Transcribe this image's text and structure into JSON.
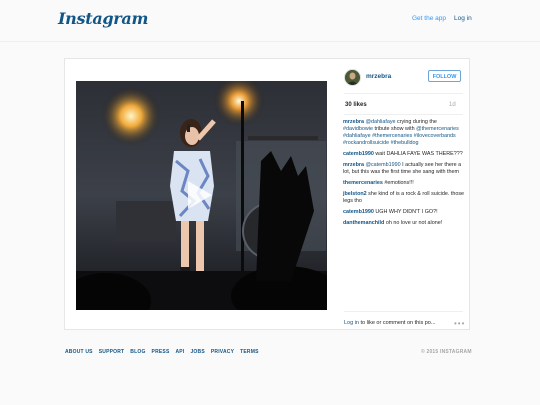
{
  "header": {
    "logo": "Instagram",
    "get_app": "Get the app",
    "login": "Log in"
  },
  "post": {
    "username": "mrzebra",
    "follow": "FOLLOW",
    "likes": "30 likes",
    "time_ago": "1d",
    "comments": [
      {
        "user": "mrzebra",
        "parts": [
          [
            "tag",
            "@dahliafaye"
          ],
          [
            "t",
            " crying during the "
          ],
          [
            "tag",
            "#davidbowie"
          ],
          [
            "t",
            " tribute show with "
          ],
          [
            "tag",
            "@themercenaries"
          ],
          [
            "t",
            " "
          ],
          [
            "tag",
            "#dahliafaye"
          ],
          [
            "t",
            " "
          ],
          [
            "tag",
            "#themercenaries"
          ],
          [
            "t",
            " "
          ],
          [
            "tag",
            "#ilovecoverbands"
          ],
          [
            "t",
            " "
          ],
          [
            "tag",
            "#rockandrollsuicide"
          ],
          [
            "t",
            " "
          ],
          [
            "tag",
            "#thebulldog"
          ]
        ]
      },
      {
        "user": "catemb1990",
        "parts": [
          [
            "t",
            "wait DAHLIA FAYE WAS THERE???"
          ]
        ]
      },
      {
        "user": "mrzebra",
        "parts": [
          [
            "tag",
            "@catemb1990"
          ],
          [
            "t",
            " I actually see her there a lot, but this was the first time she sang with them"
          ]
        ]
      },
      {
        "user": "themercenaries",
        "parts": [
          [
            "t",
            "#emotions!!!"
          ]
        ]
      },
      {
        "user": "jbelston2",
        "parts": [
          [
            "t",
            "she kind of is a rock & roll suicide. those legs tho"
          ]
        ]
      },
      {
        "user": "catemb1990",
        "parts": [
          [
            "t",
            "UGH WHY DIDN'T I GO?!"
          ]
        ]
      },
      {
        "user": "danthemanchild",
        "parts": [
          [
            "t",
            "oh no love ur not alone!"
          ]
        ]
      }
    ],
    "login_link": "Log in",
    "login_rest": " to like or comment on this po...",
    "more": "•••"
  },
  "footer": {
    "links": [
      "ABOUT US",
      "SUPPORT",
      "BLOG",
      "PRESS",
      "API",
      "JOBS",
      "PRIVACY",
      "TERMS"
    ],
    "copyright": "© 2015 INSTAGRAM"
  },
  "colors": {
    "link": "#125688",
    "accent_blue": "#3897f0",
    "muted": "#a5a7aa"
  }
}
